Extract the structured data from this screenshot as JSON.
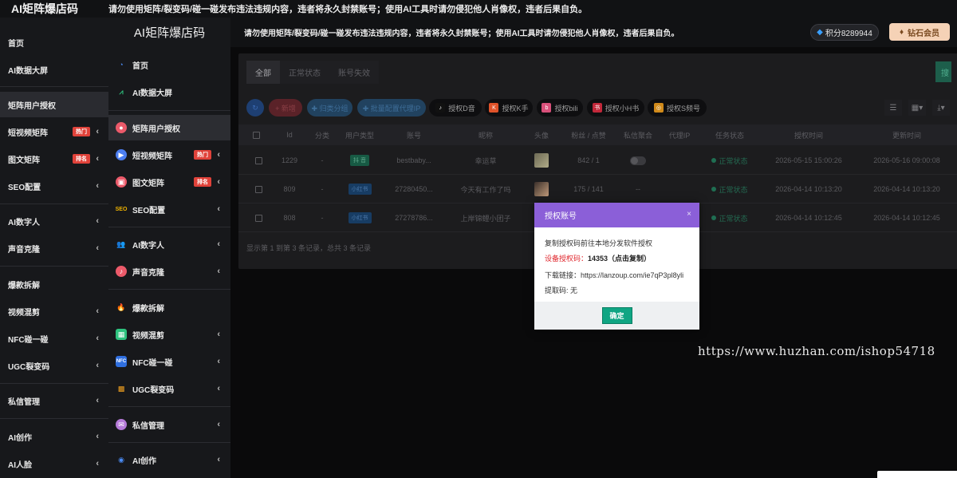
{
  "back": {
    "logo": "AI矩阵爆店码",
    "notice": "请勿使用矩阵/裂变码/碰一碰发布违法违规内容，违者将永久封禁账号；使用AI工具时请勿侵犯他人肖像权，违者后果自负。",
    "menu": [
      {
        "label": "首页"
      },
      {
        "label": "AI数据大屏"
      },
      {
        "label": "矩阵用户授权"
      },
      {
        "label": "短视频矩阵",
        "badge": "热门"
      },
      {
        "label": "图文矩阵",
        "badge": "排名"
      },
      {
        "label": "SEO配置"
      },
      {
        "label": "AI数字人"
      },
      {
        "label": "声音克隆"
      },
      {
        "label": "爆款拆解"
      },
      {
        "label": "视频混剪"
      },
      {
        "label": "NFC碰一碰"
      },
      {
        "label": "UGC裂变码"
      },
      {
        "label": "私信管理"
      },
      {
        "label": "AI创作"
      },
      {
        "label": "AI人脸"
      }
    ]
  },
  "sidebar": {
    "logo": "AI矩阵爆店码",
    "items": [
      {
        "label": "首页",
        "icon": "pie-chart-icon"
      },
      {
        "label": "AI数据大屏",
        "icon": "line-chart-icon"
      },
      {
        "label": "矩阵用户授权",
        "icon": "user-auth-icon"
      },
      {
        "label": "短视频矩阵",
        "icon": "video-icon",
        "badge": "热门"
      },
      {
        "label": "图文矩阵",
        "icon": "image-text-icon",
        "badge": "排名"
      },
      {
        "label": "SEO配置",
        "icon": "seo-icon"
      },
      {
        "label": "AI数字人",
        "icon": "digital-human-icon"
      },
      {
        "label": "声音克隆",
        "icon": "voice-icon"
      },
      {
        "label": "爆款拆解",
        "icon": "fire-icon"
      },
      {
        "label": "视频混剪",
        "icon": "film-icon"
      },
      {
        "label": "NFC碰一碰",
        "icon": "nfc-icon"
      },
      {
        "label": "UGC裂变码",
        "icon": "qrcode-icon"
      },
      {
        "label": "私信管理",
        "icon": "message-icon"
      },
      {
        "label": "AI创作",
        "icon": "ai-create-icon"
      }
    ]
  },
  "header": {
    "notice": "请勿使用矩阵/裂变码/碰一碰发布违法违规内容，违者将永久封禁账号；使用AI工具时请勿侵犯他人肖像权，违者后果自负。",
    "points": "积分8289944",
    "vip": "钻石会员"
  },
  "tabs": [
    "全部",
    "正常状态",
    "账号失效"
  ],
  "toolbar": {
    "refresh": "↻",
    "add": "+ 新增",
    "group": "✚ 归类分组",
    "batch": "✚ 批量配置代理IP",
    "platforms": [
      "授权D音",
      "授权K手",
      "授权bili",
      "授权小H书",
      "授权S频号"
    ]
  },
  "table": {
    "headers": [
      "Id",
      "分类",
      "用户类型",
      "账号",
      "昵称",
      "头像",
      "粉丝 / 点赞",
      "私信聚合",
      "代理IP",
      "任务状态",
      "授权时间",
      "更新时间"
    ],
    "rows": [
      {
        "id": "1229",
        "category": "-",
        "type": "抖 音",
        "account": "bestbaby...",
        "nickname": "幸运草",
        "fans": "842 / 1",
        "agg": "toggle",
        "proxy": "",
        "status": "正常状态",
        "auth_time": "2026-05-15 15:00:26",
        "update_time": "2026-05-16 09:00:08"
      },
      {
        "id": "809",
        "category": "-",
        "type": "小红书",
        "account": "27280450...",
        "nickname": "今天有工作了吗",
        "fans": "175 / 141",
        "agg": "--",
        "proxy": "",
        "status": "正常状态",
        "auth_time": "2026-04-14 10:13:20",
        "update_time": "2026-04-14 10:13:20"
      },
      {
        "id": "808",
        "category": "-",
        "type": "小红书",
        "account": "27278786...",
        "nickname": "上岸锦鲤小团子",
        "fans": "",
        "agg": "",
        "proxy": "",
        "status": "正常状态",
        "auth_time": "2026-04-14 10:12:45",
        "update_time": "2026-04-14 10:12:45"
      }
    ],
    "footer": "显示第 1 到第 3 条记录，总共 3 条记录"
  },
  "dialog": {
    "title": "授权账号",
    "close": "×",
    "line1": "复制授权码前往本地分发软件授权",
    "code_label": "设备授权码：",
    "code_value": "14353（点击复制）",
    "download": "下载链接：https://lanzoup.com/ie7qP3pl8yli",
    "extract": "提取码: 无",
    "ok": "确定"
  },
  "watermark": "https://www.huzhan.com/ishop54718",
  "colors": {
    "dialog_header": "#8b5fd8",
    "ok_button": "#10a583",
    "badge": "#e0423a",
    "vip": "#f5d2b6"
  }
}
